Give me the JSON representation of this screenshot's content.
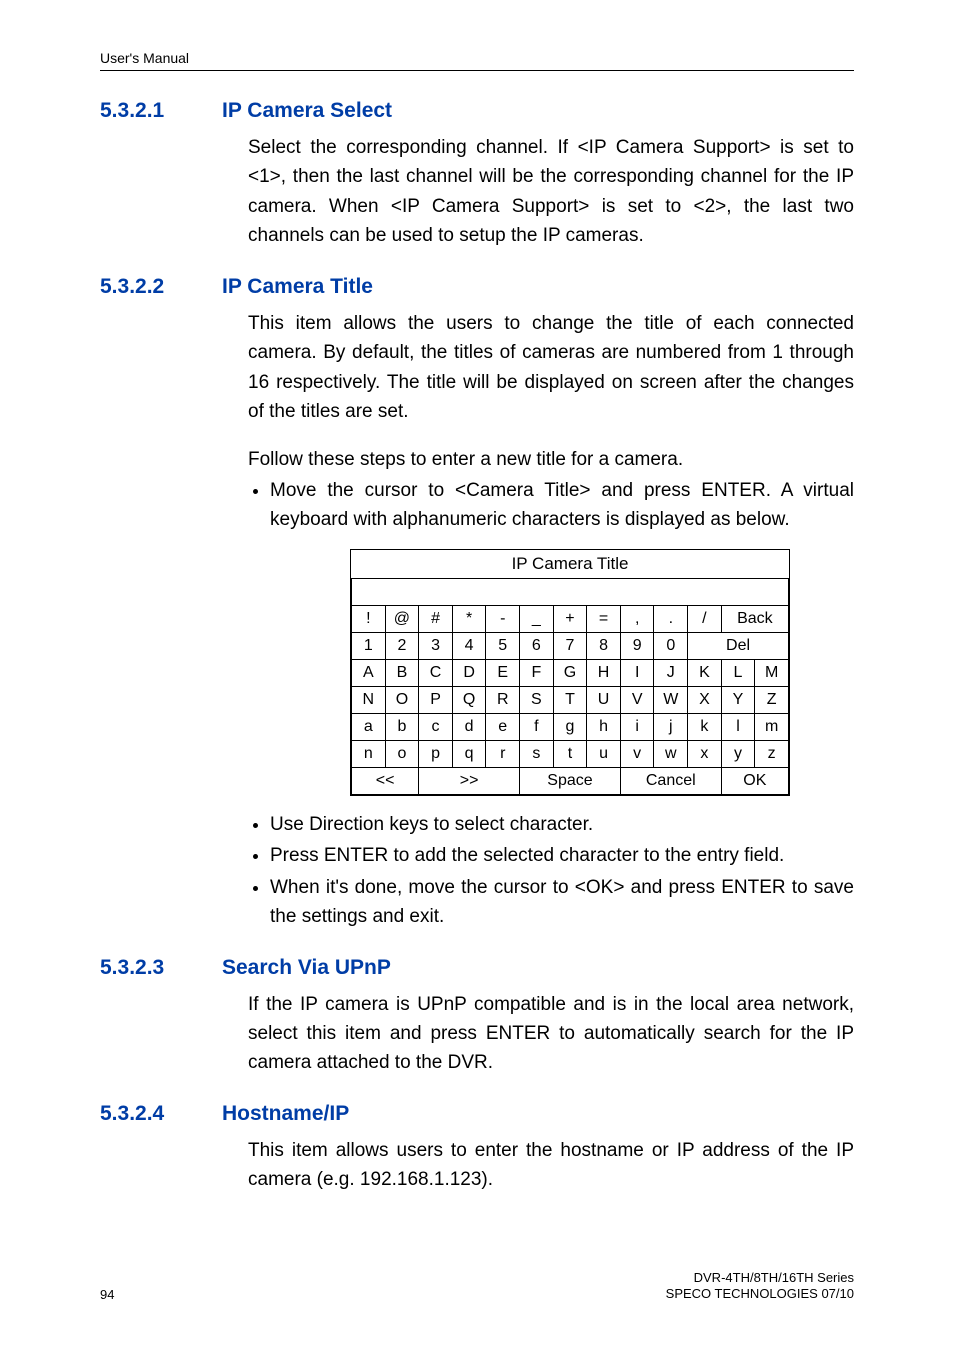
{
  "header": {
    "title": "User's Manual"
  },
  "sections": {
    "s1": {
      "num": "5.3.2.1",
      "title": "IP Camera Select",
      "para": "Select the corresponding channel. If <IP Camera Support> is set to <1>, then the last channel will be the corresponding channel for the IP camera. When <IP Camera Support> is set to <2>, the last two channels can be used to setup the IP cameras."
    },
    "s2": {
      "num": "5.3.2.2",
      "title": "IP Camera Title",
      "para1": "This item allows the users to change the title of each connected camera. By default, the titles of cameras are numbered from 1 through 16 respectively. The title will be displayed on screen after the changes of the titles are set.",
      "para2": "Follow these steps to enter a new title for a camera.",
      "bul1": "Move the cursor to <Camera Title> and press ENTER. A virtual keyboard with alphanumeric characters is displayed as below.",
      "bul2": "Use Direction keys to select character.",
      "bul3": "Press ENTER to add the selected character to the entry field.",
      "bul4": "When it's done, move the cursor to <OK> and press ENTER to save the settings and exit."
    },
    "s3": {
      "num": "5.3.2.3",
      "title": "Search Via UPnP",
      "para": "If the IP camera is UPnP compatible and is in the local area network, select this item and press ENTER to automatically search for the IP camera attached to the DVR."
    },
    "s4": {
      "num": "5.3.2.4",
      "title": "Hostname/IP",
      "para": "This item allows users to enter the hostname or IP address of the IP camera (e.g. 192.168.1.123)."
    }
  },
  "keyboard": {
    "title": "IP Camera Title",
    "row1": [
      "!",
      "@",
      "#",
      "*",
      "-",
      "_",
      "+",
      "=",
      ",",
      ".",
      "/"
    ],
    "row1_back": "Back",
    "row2": [
      "1",
      "2",
      "3",
      "4",
      "5",
      "6",
      "7",
      "8",
      "9",
      "0"
    ],
    "row2_del": "Del",
    "row3": [
      "A",
      "B",
      "C",
      "D",
      "E",
      "F",
      "G",
      "H",
      "I",
      "J",
      "K",
      "L",
      "M"
    ],
    "row4": [
      "N",
      "O",
      "P",
      "Q",
      "R",
      "S",
      "T",
      "U",
      "V",
      "W",
      "X",
      "Y",
      "Z"
    ],
    "row5": [
      "a",
      "b",
      "c",
      "d",
      "e",
      "f",
      "g",
      "h",
      "i",
      "j",
      "k",
      "l",
      "m"
    ],
    "row6": [
      "n",
      "o",
      "p",
      "q",
      "r",
      "s",
      "t",
      "u",
      "v",
      "w",
      "x",
      "y",
      "z"
    ],
    "bottom": {
      "prev": "<<",
      "next": ">>",
      "space": "Space",
      "cancel": "Cancel",
      "ok": "OK"
    }
  },
  "footer": {
    "page": "94",
    "line1": "DVR-4TH/8TH/16TH Series",
    "line2": "SPECO TECHNOLOGIES 07/10"
  }
}
